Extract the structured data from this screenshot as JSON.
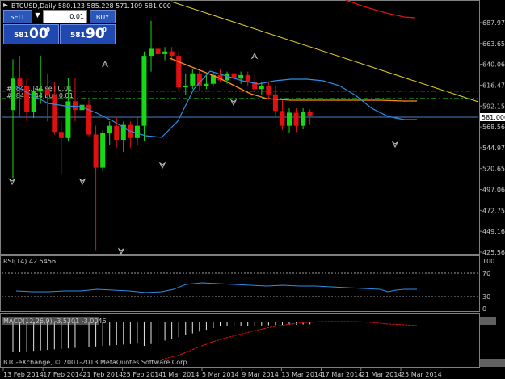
{
  "window": {
    "title": "BTCUSD,Daily  580.123 585.228 571.109 581.000"
  },
  "trade_panel": {
    "sell_label": "SELL",
    "buy_label": "BUY",
    "lot_value": "0.01",
    "sell_price_prefix": "581",
    "sell_price_big": "00",
    "sell_price_sup": "0",
    "buy_price_prefix": "581",
    "buy_price_big": "90",
    "buy_price_sup": "0"
  },
  "order_labels": [
    "#0844...44 sell 0.01",
    "#0844...44 buy 0.01"
  ],
  "price_axis_labels": [
    "687.970",
    "663.650",
    "640.065",
    "616.470",
    "592.155",
    "568.565",
    "544.970",
    "520.655",
    "497.065",
    "472.755",
    "449.160",
    "425.565"
  ],
  "current_price_label": "581.000",
  "date_labels": [
    "13 Feb 2014",
    "17 Feb 2014",
    "21 Feb 2014",
    "25 Feb 2014",
    "1 Mar 2014",
    "5 Mar 2014",
    "9 Mar 2014",
    "13 Mar 2014",
    "17 Mar 2014",
    "21 Mar 2014",
    "25 Mar 2014"
  ],
  "rsi": {
    "title": "RSI(14) 42.5456",
    "levels": [
      "100",
      "70",
      "30",
      "0"
    ]
  },
  "macd": {
    "title": "MACD(12,26,9) -3.5301 -3.0046"
  },
  "footer": "BTC-eXchange, © 2001-2013 MetaQuotes Software Corp.",
  "colors": {
    "bull": "#16d816",
    "bear": "#e01010",
    "ma_fast": "#2b8fe6",
    "ma_slow": "#ff8c1a",
    "trend": "#e6d31f",
    "ma_top": "#e01010"
  },
  "chart_data": {
    "type": "candlestick",
    "symbol": "BTCUSD",
    "timeframe": "Daily",
    "ylim": [
      425.565,
      700
    ],
    "candles": [
      {
        "o": 588,
        "h": 646,
        "l": 510,
        "c": 624
      },
      {
        "o": 624,
        "h": 650,
        "l": 580,
        "c": 615
      },
      {
        "o": 615,
        "h": 624,
        "l": 575,
        "c": 586
      },
      {
        "o": 586,
        "h": 615,
        "l": 579,
        "c": 610
      },
      {
        "o": 610,
        "h": 650,
        "l": 595,
        "c": 612
      },
      {
        "o": 612,
        "h": 630,
        "l": 575,
        "c": 606
      },
      {
        "o": 606,
        "h": 620,
        "l": 560,
        "c": 563
      },
      {
        "o": 563,
        "h": 575,
        "l": 515,
        "c": 556
      },
      {
        "o": 556,
        "h": 625,
        "l": 552,
        "c": 598
      },
      {
        "o": 598,
        "h": 625,
        "l": 575,
        "c": 588
      },
      {
        "o": 588,
        "h": 600,
        "l": 575,
        "c": 594
      },
      {
        "o": 594,
        "h": 600,
        "l": 558,
        "c": 560
      },
      {
        "o": 560,
        "h": 570,
        "l": 428,
        "c": 522
      },
      {
        "o": 522,
        "h": 565,
        "l": 518,
        "c": 562
      },
      {
        "o": 562,
        "h": 575,
        "l": 548,
        "c": 570
      },
      {
        "o": 570,
        "h": 580,
        "l": 545,
        "c": 554
      },
      {
        "o": 554,
        "h": 575,
        "l": 540,
        "c": 571
      },
      {
        "o": 571,
        "h": 575,
        "l": 545,
        "c": 556
      },
      {
        "o": 556,
        "h": 580,
        "l": 548,
        "c": 570
      },
      {
        "o": 570,
        "h": 655,
        "l": 553,
        "c": 650
      },
      {
        "o": 650,
        "h": 690,
        "l": 632,
        "c": 658
      },
      {
        "o": 658,
        "h": 692,
        "l": 645,
        "c": 652
      },
      {
        "o": 652,
        "h": 660,
        "l": 645,
        "c": 655
      },
      {
        "o": 655,
        "h": 660,
        "l": 645,
        "c": 650
      },
      {
        "o": 650,
        "h": 655,
        "l": 610,
        "c": 614
      },
      {
        "o": 614,
        "h": 630,
        "l": 605,
        "c": 616
      },
      {
        "o": 616,
        "h": 635,
        "l": 612,
        "c": 630
      },
      {
        "o": 630,
        "h": 635,
        "l": 610,
        "c": 615
      },
      {
        "o": 615,
        "h": 628,
        "l": 612,
        "c": 618
      },
      {
        "o": 618,
        "h": 632,
        "l": 615,
        "c": 628
      },
      {
        "o": 628,
        "h": 635,
        "l": 620,
        "c": 622
      },
      {
        "o": 622,
        "h": 632,
        "l": 618,
        "c": 630
      },
      {
        "o": 630,
        "h": 635,
        "l": 620,
        "c": 624
      },
      {
        "o": 624,
        "h": 632,
        "l": 618,
        "c": 628
      },
      {
        "o": 628,
        "h": 632,
        "l": 615,
        "c": 620
      },
      {
        "o": 620,
        "h": 628,
        "l": 610,
        "c": 612
      },
      {
        "o": 612,
        "h": 620,
        "l": 605,
        "c": 615
      },
      {
        "o": 615,
        "h": 620,
        "l": 600,
        "c": 606
      },
      {
        "o": 606,
        "h": 615,
        "l": 582,
        "c": 587
      },
      {
        "o": 587,
        "h": 600,
        "l": 565,
        "c": 570
      },
      {
        "o": 570,
        "h": 590,
        "l": 562,
        "c": 585
      },
      {
        "o": 585,
        "h": 590,
        "l": 563,
        "c": 570
      },
      {
        "o": 570,
        "h": 590,
        "l": 566,
        "c": 586
      },
      {
        "o": 586,
        "h": 589,
        "l": 571,
        "c": 581
      }
    ]
  }
}
